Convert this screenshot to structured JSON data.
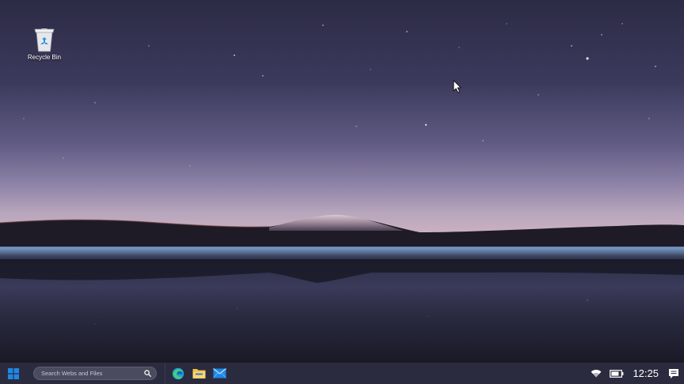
{
  "desktop": {
    "icons": [
      {
        "label": "Recycle Bin",
        "icon": "recycle-bin-icon"
      }
    ]
  },
  "taskbar": {
    "start_icon": "windows-logo-icon",
    "search": {
      "placeholder": "Search Webs and Files",
      "icon": "search-icon"
    },
    "apps": [
      {
        "icon": "edge-browser-icon"
      },
      {
        "icon": "file-explorer-icon"
      },
      {
        "icon": "mail-icon"
      }
    ],
    "tray": {
      "wifi_icon": "wifi-icon",
      "battery_icon": "battery-icon",
      "clock": "12:25",
      "notification_icon": "notification-icon"
    }
  },
  "colors": {
    "taskbar_bg": "#2b2b3f",
    "search_bg": "#4a4b5e",
    "accent_blue": "#1e88e5",
    "folder_yellow": "#f5c242"
  }
}
